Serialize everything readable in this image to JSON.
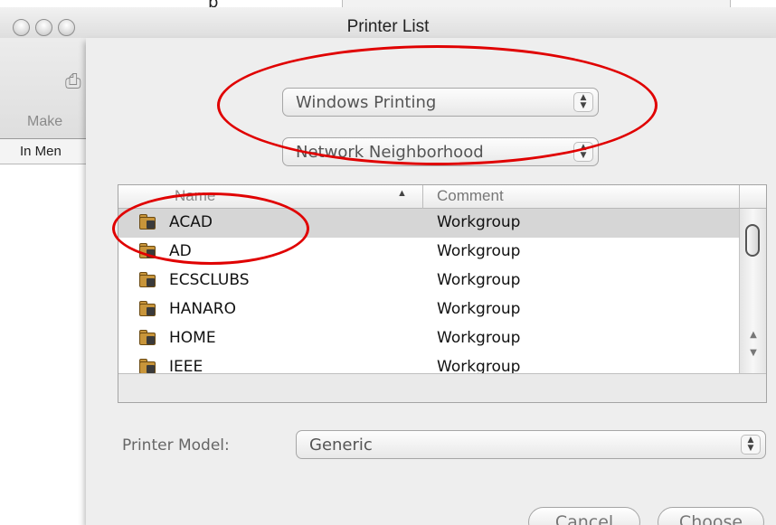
{
  "window": {
    "title": "Printer List",
    "top_partial_text": "p"
  },
  "back_window": {
    "toolbar_label": "Make",
    "column_header": "In Men"
  },
  "sheet": {
    "connection_popup": "Windows Printing",
    "browse_popup": "Network Neighborhood",
    "list": {
      "columns": [
        {
          "label": "Name",
          "sorted": "ascending",
          "sort_indicator": "▲"
        },
        {
          "label": "Comment"
        }
      ],
      "rows": [
        {
          "name": "ACAD",
          "comment": "Workgroup",
          "selected": true
        },
        {
          "name": "AD",
          "comment": "Workgroup",
          "selected": false
        },
        {
          "name": "ECSCLUBS",
          "comment": "Workgroup",
          "selected": false
        },
        {
          "name": "HANARO",
          "comment": "Workgroup",
          "selected": false
        },
        {
          "name": "HOME",
          "comment": "Workgroup",
          "selected": false
        },
        {
          "name": "IEEE",
          "comment": "Workgroup",
          "selected": false
        }
      ],
      "row_icon": "network-folder-icon"
    },
    "printer_model_label": "Printer Model:",
    "printer_model_value": "Generic",
    "buttons": {
      "cancel": "Cancel",
      "choose": "Choose"
    }
  },
  "annotations": {
    "highlight_color": "#e00000"
  },
  "colors": {
    "selected_row": "#d6d6d6",
    "sheet_background": "#eeeeee",
    "desktop": "#2a4fa3"
  }
}
